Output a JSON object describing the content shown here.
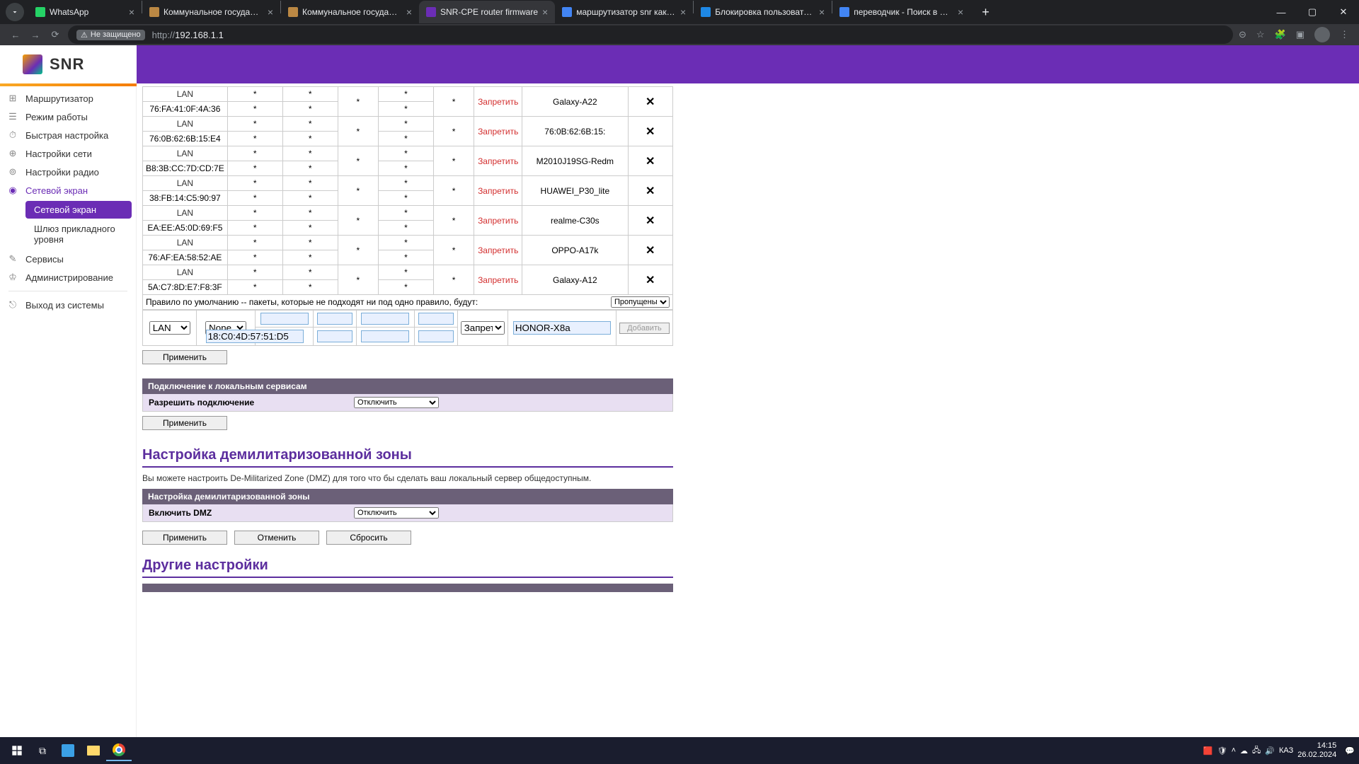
{
  "browser": {
    "tabs": [
      {
        "title": "WhatsApp",
        "icon": "whatsapp"
      },
      {
        "title": "Коммунальное государственн",
        "icon": "gov"
      },
      {
        "title": "Коммунальное государственн",
        "icon": "gov"
      },
      {
        "title": "SNR-CPE router firmware",
        "icon": "snr",
        "active": true
      },
      {
        "title": "маршрутизатор snr как забло",
        "icon": "google"
      },
      {
        "title": "Блокировка пользователя по",
        "icon": "n"
      },
      {
        "title": "переводчик - Поиск в Google",
        "icon": "google"
      }
    ],
    "not_secure": "Не защищено",
    "url": "192.168.1.1",
    "url_prefix": "http://"
  },
  "logo": "SNR",
  "sidebar": {
    "items": [
      {
        "label": "Маршрутизатор",
        "icon": "router"
      },
      {
        "label": "Режим работы",
        "icon": "mode"
      },
      {
        "label": "Быстрая настройка",
        "icon": "speed"
      },
      {
        "label": "Настройки сети",
        "icon": "net"
      },
      {
        "label": "Настройки радио",
        "icon": "wifi"
      },
      {
        "label": "Сетевой экран",
        "icon": "shield",
        "active": true,
        "sub": [
          {
            "label": "Сетевой экран",
            "active": true
          },
          {
            "label": "Шлюз прикладного уровня"
          }
        ]
      },
      {
        "label": "Сервисы",
        "icon": "wrench"
      },
      {
        "label": "Администрирование",
        "icon": "admin"
      },
      {
        "label": "Выход из системы",
        "icon": "exit",
        "sep": true
      }
    ]
  },
  "rules": [
    {
      "if": "LAN",
      "mac": "76:FA:41:0F:4A:36",
      "act": "Запретить",
      "name": "Galaxy-A22"
    },
    {
      "if": "LAN",
      "mac": "76:0B:62:6B:15:E4",
      "act": "Запретить",
      "name": "76:0B:62:6B:15:"
    },
    {
      "if": "LAN",
      "mac": "B8:3B:CC:7D:CD:7E",
      "act": "Запретить",
      "name": "M2010J19SG-Redm"
    },
    {
      "if": "LAN",
      "mac": "38:FB:14:C5:90:97",
      "act": "Запретить",
      "name": "HUAWEI_P30_lite"
    },
    {
      "if": "LAN",
      "mac": "EA:EE:A5:0D:69:F5",
      "act": "Запретить",
      "name": "realme-C30s"
    },
    {
      "if": "LAN",
      "mac": "76:AF:EA:58:52:AE",
      "act": "Запретить",
      "name": "OPPO-A17k"
    },
    {
      "if": "LAN",
      "mac": "5A:C7:8D:E7:F8:3F",
      "act": "Запретить",
      "name": "Galaxy-A12"
    }
  ],
  "default_rule_text": "Правило по умолчанию -- пакеты, которые не подходят ни под одно правило, будут:",
  "default_select": "Пропущены",
  "add_row": {
    "if": "LAN",
    "proto": "None",
    "mac": "18:C0:4D:57:51:D5",
    "action": "Запретит",
    "name": "HONOR-X8a",
    "add_btn": "Добавить"
  },
  "apply_btn": "Применить",
  "local_services": {
    "header": "Подключение к локальным сервисам",
    "allow_label": "Разрешить подключение",
    "select": "Отключить"
  },
  "dmz": {
    "title": "Настройка демилитаризованной зоны",
    "desc": "Вы можете настроить De-Militarized Zone (DMZ) для того что бы сделать ваш локальный сервер общедоступным.",
    "header": "Настройка демилитаризованной зоны",
    "enable_label": "Включить DMZ",
    "select": "Отключить",
    "apply": "Применить",
    "cancel": "Отменить",
    "reset": "Сбросить"
  },
  "other_title": "Другие настройки",
  "taskbar": {
    "lang": "КАЗ",
    "time": "14:15",
    "date": "26.02.2024"
  }
}
